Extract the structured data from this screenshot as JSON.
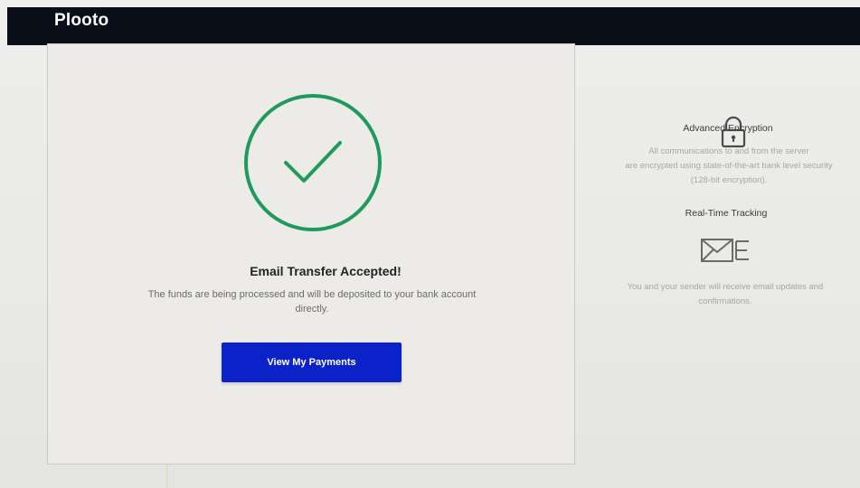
{
  "app": {
    "brand": "Plooto"
  },
  "confirmation": {
    "title": "Email Transfer Accepted!",
    "message_line1": "The funds are being processed and will be deposited to your bank account",
    "message_line2": "directly.",
    "button_label": "View My Payments",
    "icon": "checkmark-circle-icon"
  },
  "security": {
    "encryption_icon": "lock-icon",
    "encryption_title": "Advanced Encryption",
    "encryption_line1": "All communications to and from the server",
    "encryption_line2": "are encrypted using state-of-the-art bank level security",
    "encryption_line3": "(128-bit encryption).",
    "tracking_title": "Real-Time Tracking",
    "tracking_icon": "envelope-icon",
    "tracking_line1": "You and your sender will receive email updates and",
    "tracking_line2": "confirmations."
  },
  "colors": {
    "topbar": "#0b0f19",
    "accent_green": "#1f9a5c",
    "button_blue": "#0a22c8"
  }
}
